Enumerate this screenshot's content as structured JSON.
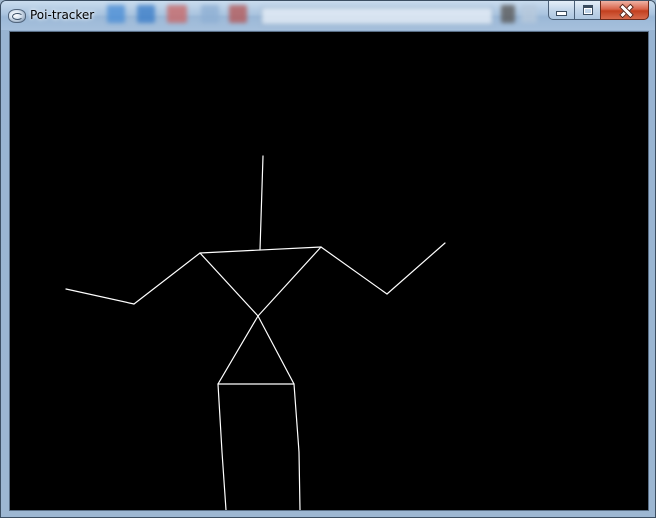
{
  "window": {
    "title": "Poi-tracker",
    "icon": "app-icon",
    "controls": {
      "minimize_icon": "minimize-icon",
      "maximize_icon": "maximize-icon",
      "close_icon": "close-icon"
    }
  },
  "colors": {
    "canvas_background": "#000000",
    "skeleton_line": "#ffffff"
  }
}
